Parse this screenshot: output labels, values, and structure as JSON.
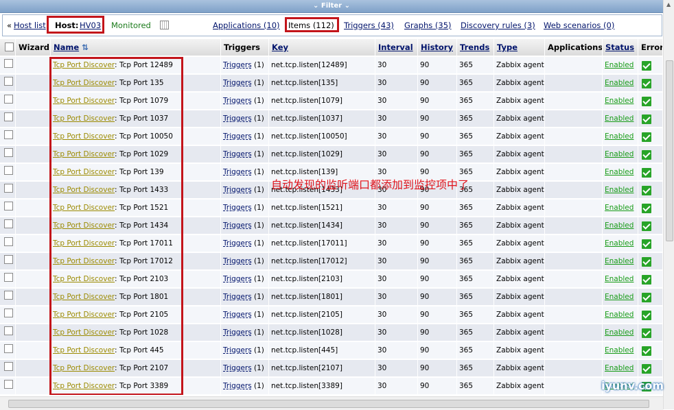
{
  "filter": {
    "label": "Filter"
  },
  "nav": {
    "back_label": "«",
    "host_list": "Host list",
    "host_label": "Host:",
    "host_name": "HV03",
    "status": "Monitored",
    "applications": "Applications (10)",
    "items": "Items (112)",
    "triggers": "Triggers (43)",
    "graphs": "Graphs (35)",
    "discovery": "Discovery rules (3)",
    "web": "Web scenarios (0)"
  },
  "columns": [
    "Wizard",
    "Name",
    "Triggers",
    "Key",
    "Interval",
    "History",
    "Trends",
    "Type",
    "Applications",
    "Status",
    "Error"
  ],
  "rows": [
    {
      "prefix": "Tcp Port Discover",
      "name": "Tcp Port 12489",
      "triggers": "Triggers",
      "tcount": "(1)",
      "key": "net.tcp.listen[12489]",
      "interval": "30",
      "history": "90",
      "trends": "365",
      "type": "Zabbix agent",
      "status": "Enabled"
    },
    {
      "prefix": "Tcp Port Discover",
      "name": "Tcp Port 135",
      "triggers": "Triggers",
      "tcount": "(1)",
      "key": "net.tcp.listen[135]",
      "interval": "30",
      "history": "90",
      "trends": "365",
      "type": "Zabbix agent",
      "status": "Enabled"
    },
    {
      "prefix": "Tcp Port Discover",
      "name": "Tcp Port 1079",
      "triggers": "Triggers",
      "tcount": "(1)",
      "key": "net.tcp.listen[1079]",
      "interval": "30",
      "history": "90",
      "trends": "365",
      "type": "Zabbix agent",
      "status": "Enabled"
    },
    {
      "prefix": "Tcp Port Discover",
      "name": "Tcp Port 1037",
      "triggers": "Triggers",
      "tcount": "(1)",
      "key": "net.tcp.listen[1037]",
      "interval": "30",
      "history": "90",
      "trends": "365",
      "type": "Zabbix agent",
      "status": "Enabled"
    },
    {
      "prefix": "Tcp Port Discover",
      "name": "Tcp Port 10050",
      "triggers": "Triggers",
      "tcount": "(1)",
      "key": "net.tcp.listen[10050]",
      "interval": "30",
      "history": "90",
      "trends": "365",
      "type": "Zabbix agent",
      "status": "Enabled"
    },
    {
      "prefix": "Tcp Port Discover",
      "name": "Tcp Port 1029",
      "triggers": "Triggers",
      "tcount": "(1)",
      "key": "net.tcp.listen[1029]",
      "interval": "30",
      "history": "90",
      "trends": "365",
      "type": "Zabbix agent",
      "status": "Enabled"
    },
    {
      "prefix": "Tcp Port Discover",
      "name": "Tcp Port 139",
      "triggers": "Triggers",
      "tcount": "(1)",
      "key": "net.tcp.listen[139]",
      "interval": "30",
      "history": "90",
      "trends": "365",
      "type": "Zabbix agent",
      "status": "Enabled"
    },
    {
      "prefix": "Tcp Port Discover",
      "name": "Tcp Port 1433",
      "triggers": "Triggers",
      "tcount": "(1)",
      "key": "net.tcp.listen[1433]",
      "interval": "30",
      "history": "90",
      "trends": "365",
      "type": "Zabbix agent",
      "status": "Enabled"
    },
    {
      "prefix": "Tcp Port Discover",
      "name": "Tcp Port 1521",
      "triggers": "Triggers",
      "tcount": "(1)",
      "key": "net.tcp.listen[1521]",
      "interval": "30",
      "history": "90",
      "trends": "365",
      "type": "Zabbix agent",
      "status": "Enabled"
    },
    {
      "prefix": "Tcp Port Discover",
      "name": "Tcp Port 1434",
      "triggers": "Triggers",
      "tcount": "(1)",
      "key": "net.tcp.listen[1434]",
      "interval": "30",
      "history": "90",
      "trends": "365",
      "type": "Zabbix agent",
      "status": "Enabled"
    },
    {
      "prefix": "Tcp Port Discover",
      "name": "Tcp Port 17011",
      "triggers": "Triggers",
      "tcount": "(1)",
      "key": "net.tcp.listen[17011]",
      "interval": "30",
      "history": "90",
      "trends": "365",
      "type": "Zabbix agent",
      "status": "Enabled"
    },
    {
      "prefix": "Tcp Port Discover",
      "name": "Tcp Port 17012",
      "triggers": "Triggers",
      "tcount": "(1)",
      "key": "net.tcp.listen[17012]",
      "interval": "30",
      "history": "90",
      "trends": "365",
      "type": "Zabbix agent",
      "status": "Enabled"
    },
    {
      "prefix": "Tcp Port Discover",
      "name": "Tcp Port 2103",
      "triggers": "Triggers",
      "tcount": "(1)",
      "key": "net.tcp.listen[2103]",
      "interval": "30",
      "history": "90",
      "trends": "365",
      "type": "Zabbix agent",
      "status": "Enabled"
    },
    {
      "prefix": "Tcp Port Discover",
      "name": "Tcp Port 1801",
      "triggers": "Triggers",
      "tcount": "(1)",
      "key": "net.tcp.listen[1801]",
      "interval": "30",
      "history": "90",
      "trends": "365",
      "type": "Zabbix agent",
      "status": "Enabled"
    },
    {
      "prefix": "Tcp Port Discover",
      "name": "Tcp Port 2105",
      "triggers": "Triggers",
      "tcount": "(1)",
      "key": "net.tcp.listen[2105]",
      "interval": "30",
      "history": "90",
      "trends": "365",
      "type": "Zabbix agent",
      "status": "Enabled"
    },
    {
      "prefix": "Tcp Port Discover",
      "name": "Tcp Port 1028",
      "triggers": "Triggers",
      "tcount": "(1)",
      "key": "net.tcp.listen[1028]",
      "interval": "30",
      "history": "90",
      "trends": "365",
      "type": "Zabbix agent",
      "status": "Enabled"
    },
    {
      "prefix": "Tcp Port Discover",
      "name": "Tcp Port 445",
      "triggers": "Triggers",
      "tcount": "(1)",
      "key": "net.tcp.listen[445]",
      "interval": "30",
      "history": "90",
      "trends": "365",
      "type": "Zabbix agent",
      "status": "Enabled"
    },
    {
      "prefix": "Tcp Port Discover",
      "name": "Tcp Port 2107",
      "triggers": "Triggers",
      "tcount": "(1)",
      "key": "net.tcp.listen[2107]",
      "interval": "30",
      "history": "90",
      "trends": "365",
      "type": "Zabbix agent",
      "status": "Enabled"
    },
    {
      "prefix": "Tcp Port Discover",
      "name": "Tcp Port 3389",
      "triggers": "Triggers",
      "tcount": "(1)",
      "key": "net.tcp.listen[3389]",
      "interval": "30",
      "history": "90",
      "trends": "365",
      "type": "Zabbix agent",
      "status": "Enabled"
    }
  ],
  "annotation": "自动发现的监听端口都添加到监控项中了",
  "watermark": "iyunv.com",
  "colors": {
    "highlight": "#c3141a",
    "link": "#00136b",
    "prefix_link": "#9b8a00",
    "enabled": "#169b16"
  }
}
